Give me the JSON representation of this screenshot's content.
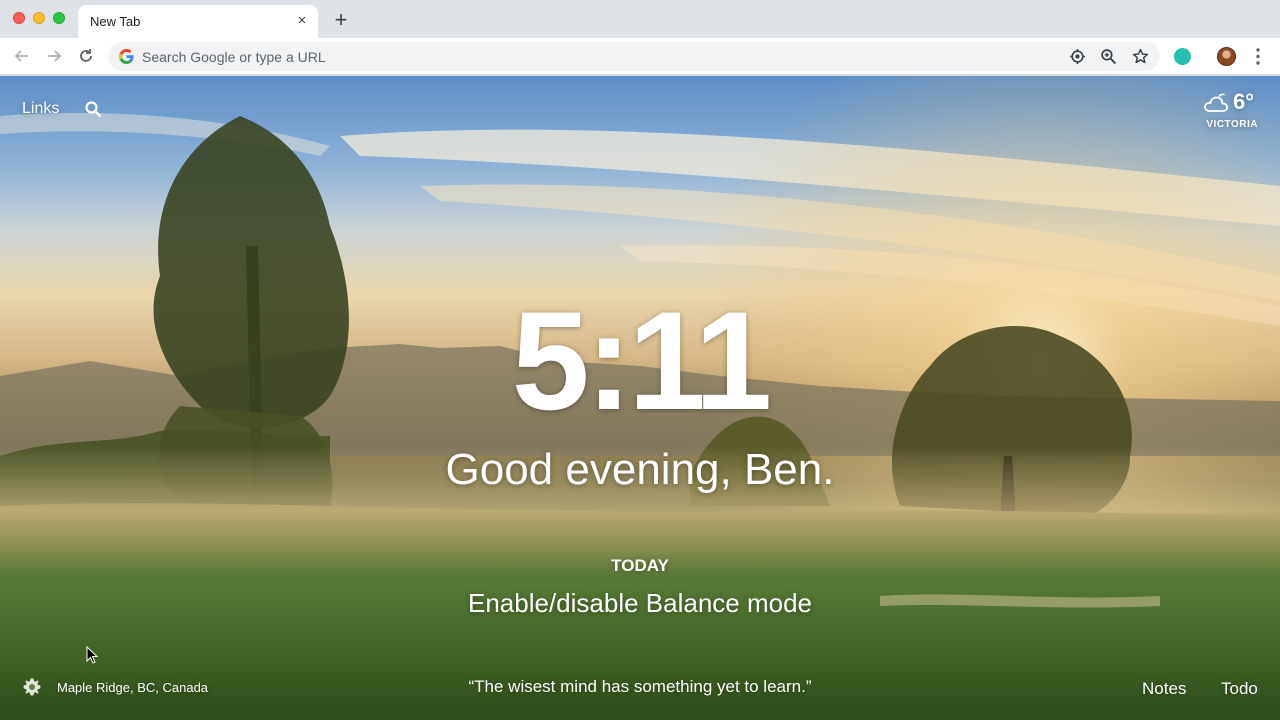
{
  "browser": {
    "tab": {
      "title": "New Tab",
      "close_glyph": "×"
    },
    "new_tab_glyph": "+",
    "omnibox": {
      "placeholder": "Search Google or type a URL"
    },
    "icons": [
      "back-icon",
      "forward-icon",
      "reload-icon",
      "google-g-icon",
      "location-icon",
      "zoom-icon",
      "bookmark-star-icon",
      "extension-icon",
      "profile-avatar",
      "menu-kebab-icon"
    ]
  },
  "momentum": {
    "links_label": "Links",
    "weather": {
      "temperature": "6°",
      "city": "VICTORIA",
      "icon": "cloud-icon"
    },
    "clock": "5:11",
    "greeting": "Good evening, Ben.",
    "focus": {
      "label": "TODAY",
      "text": "Enable/disable Balance mode"
    },
    "location": "Maple Ridge, BC, Canada",
    "quote": "“The wisest mind has something yet to learn.”",
    "notes_label": "Notes",
    "todo_label": "Todo"
  },
  "colors": {
    "tabstrip": "#dee1e6",
    "toolbar": "#ffffff",
    "omnibox": "#f1f3f4",
    "extension_teal": "#26c1ac",
    "text_on_background": "#ffffff"
  }
}
